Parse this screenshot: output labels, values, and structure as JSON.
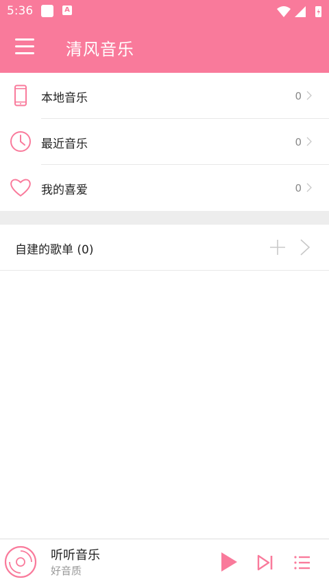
{
  "status_bar": {
    "time": "5:36",
    "app_icon_letter": "A"
  },
  "app_bar": {
    "title": "清风音乐"
  },
  "menu": [
    {
      "label": "本地音乐",
      "count": "0",
      "icon": "phone-icon"
    },
    {
      "label": "最近音乐",
      "count": "0",
      "icon": "clock-icon"
    },
    {
      "label": "我的喜爱",
      "count": "0",
      "icon": "heart-icon"
    }
  ],
  "playlists": {
    "label": "自建的歌单 (0)"
  },
  "player": {
    "title": "听听音乐",
    "subtitle": "好音质"
  },
  "colors": {
    "accent": "#f97a9b",
    "divider": "#e8e8e8",
    "gap": "#ededed"
  }
}
